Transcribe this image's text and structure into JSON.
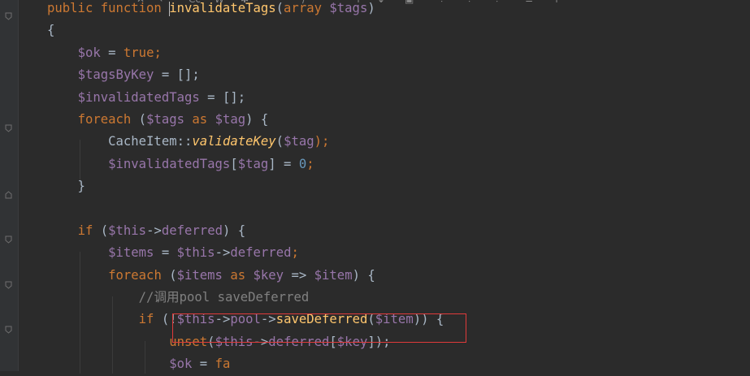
{
  "editor": {
    "lines": [
      [
        {
          "t": "public function ",
          "c": "kw"
        },
        {
          "t": "",
          "c": "cursor"
        },
        {
          "t": "invalidateTags",
          "c": "fn"
        },
        {
          "t": "(",
          "c": "plain"
        },
        {
          "t": "array ",
          "c": "kw"
        },
        {
          "t": "$tags",
          "c": "var"
        },
        {
          "t": ")",
          "c": "plain"
        }
      ],
      [
        {
          "t": "{",
          "c": "plain"
        }
      ],
      [
        {
          "t": "    ",
          "c": "plain"
        },
        {
          "t": "$ok",
          "c": "var"
        },
        {
          "t": " = ",
          "c": "plain"
        },
        {
          "t": "true",
          "c": "kw"
        },
        {
          "t": ";",
          "c": "kw"
        }
      ],
      [
        {
          "t": "    ",
          "c": "plain"
        },
        {
          "t": "$tagsByKey",
          "c": "var"
        },
        {
          "t": " = [];",
          "c": "plain"
        }
      ],
      [
        {
          "t": "    ",
          "c": "plain"
        },
        {
          "t": "$invalidatedTags",
          "c": "var"
        },
        {
          "t": " = [];",
          "c": "plain"
        }
      ],
      [
        {
          "t": "    ",
          "c": "plain"
        },
        {
          "t": "foreach",
          "c": "kw"
        },
        {
          "t": " (",
          "c": "plain"
        },
        {
          "t": "$tags",
          "c": "var"
        },
        {
          "t": " as ",
          "c": "kw"
        },
        {
          "t": "$tag",
          "c": "var"
        },
        {
          "t": ") {",
          "c": "plain"
        }
      ],
      [
        {
          "t": "        CacheItem::",
          "c": "plain"
        },
        {
          "t": "validateKey",
          "c": "fni"
        },
        {
          "t": "(",
          "c": "plain"
        },
        {
          "t": "$tag",
          "c": "var"
        },
        {
          "t": ");",
          "c": "kw"
        }
      ],
      [
        {
          "t": "        ",
          "c": "plain"
        },
        {
          "t": "$invalidatedTags",
          "c": "var"
        },
        {
          "t": "[",
          "c": "plain"
        },
        {
          "t": "$tag",
          "c": "var"
        },
        {
          "t": "] = ",
          "c": "plain"
        },
        {
          "t": "0",
          "c": "num"
        },
        {
          "t": ";",
          "c": "kw"
        }
      ],
      [
        {
          "t": "    }",
          "c": "plain"
        }
      ],
      [
        {
          "t": "",
          "c": "plain"
        }
      ],
      [
        {
          "t": "    ",
          "c": "plain"
        },
        {
          "t": "if",
          "c": "kw"
        },
        {
          "t": " (",
          "c": "plain"
        },
        {
          "t": "$this",
          "c": "var"
        },
        {
          "t": "->",
          "c": "plain"
        },
        {
          "t": "deferred",
          "c": "var"
        },
        {
          "t": ") {",
          "c": "plain"
        }
      ],
      [
        {
          "t": "        ",
          "c": "plain"
        },
        {
          "t": "$items",
          "c": "var"
        },
        {
          "t": " = ",
          "c": "plain"
        },
        {
          "t": "$this",
          "c": "var"
        },
        {
          "t": "->",
          "c": "plain"
        },
        {
          "t": "deferred",
          "c": "var"
        },
        {
          "t": ";",
          "c": "kw"
        }
      ],
      [
        {
          "t": "        ",
          "c": "plain"
        },
        {
          "t": "foreach",
          "c": "kw"
        },
        {
          "t": " (",
          "c": "plain"
        },
        {
          "t": "$items",
          "c": "var"
        },
        {
          "t": " as ",
          "c": "kw"
        },
        {
          "t": "$key",
          "c": "var"
        },
        {
          "t": " => ",
          "c": "plain"
        },
        {
          "t": "$item",
          "c": "var"
        },
        {
          "t": ") {",
          "c": "plain"
        }
      ],
      [
        {
          "t": "            ",
          "c": "plain"
        },
        {
          "t": "//调用pool saveDeferred",
          "c": "cmt"
        }
      ],
      [
        {
          "t": "            ",
          "c": "plain"
        },
        {
          "t": "if",
          "c": "kw"
        },
        {
          "t": " (!",
          "c": "plain"
        },
        {
          "t": "$this",
          "c": "var"
        },
        {
          "t": "->",
          "c": "plain"
        },
        {
          "t": "pool",
          "c": "var"
        },
        {
          "t": "->",
          "c": "plain"
        },
        {
          "t": "saveDeferred",
          "c": "fn"
        },
        {
          "t": "(",
          "c": "plain"
        },
        {
          "t": "$item",
          "c": "var"
        },
        {
          "t": ")) {",
          "c": "plain"
        }
      ],
      [
        {
          "t": "                ",
          "c": "plain"
        },
        {
          "t": "unset",
          "c": "kw"
        },
        {
          "t": "(",
          "c": "plain"
        },
        {
          "t": "$this",
          "c": "var"
        },
        {
          "t": "->",
          "c": "plain"
        },
        {
          "t": "deferred",
          "c": "var"
        },
        {
          "t": "[",
          "c": "plain"
        },
        {
          "t": "$key",
          "c": "var"
        },
        {
          "t": "]);",
          "c": "plain"
        }
      ],
      [
        {
          "t": "                ",
          "c": "plain"
        },
        {
          "t": "$ok",
          "c": "var"
        },
        {
          "t": " = ",
          "c": "plain"
        },
        {
          "t": "fa",
          "c": "kw"
        }
      ]
    ]
  },
  "colors": {
    "keyword": "#cc7832",
    "variable": "#9876aa",
    "function": "#ffc66d",
    "number": "#6897bb",
    "comment": "#808080",
    "text": "#a9b7c6",
    "background": "#2b2b2b",
    "annotation_box": "#e03a3a"
  },
  "toolbar_icons": [
    "close-icon",
    "undo-icon",
    "case-icon",
    "word-icon",
    "regex-icon",
    "filter-icon",
    "up-icon",
    "down-icon",
    "select-all-icon",
    "split-icon",
    "align-icon",
    "pin-icon"
  ]
}
